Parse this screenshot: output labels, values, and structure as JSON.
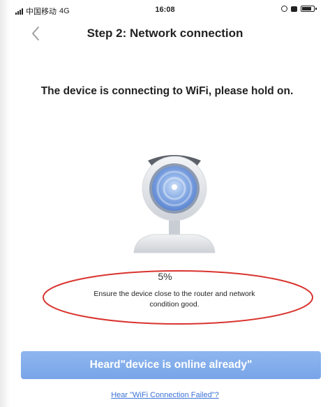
{
  "status_bar": {
    "carrier": "中国移动",
    "network": "4G",
    "time": "16:08"
  },
  "nav": {
    "back_icon": "chevron-left-icon",
    "title": "Step 2: Network connection"
  },
  "main": {
    "headline": "The device is connecting to WiFi, please hold on.",
    "device_icon": "webcam-icon",
    "progress_percent": "5%",
    "hint_line1": "Ensure the device close to the router and network",
    "hint_line2": "condition good."
  },
  "actions": {
    "online_button_label": "Heard\"device is online already\"",
    "failed_link_label": "Hear \"WiFi Connection Failed\"?"
  },
  "colors": {
    "button": "#78a5e8",
    "link": "#3a72d8",
    "annotation": "#d9332e"
  }
}
